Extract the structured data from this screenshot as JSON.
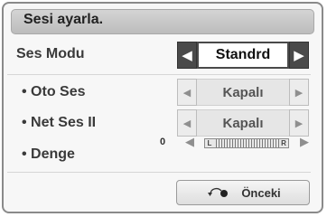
{
  "title": "Sesi ayarla.",
  "rows": {
    "ses_modu": {
      "label": "Ses Modu",
      "value": "Standrd",
      "left_icon": "left-arrow-icon",
      "right_icon": "right-arrow-icon"
    },
    "oto_ses": {
      "label": "• Oto Ses",
      "value": "Kapalı"
    },
    "net_ses": {
      "label": "• Net Ses II",
      "value": "Kapalı"
    },
    "denge": {
      "label": "• Denge",
      "value": "0",
      "left_mark": "L",
      "right_mark": "R",
      "level": 0.5
    }
  },
  "back_button": {
    "label": "Önceki",
    "icon": "return-icon"
  },
  "glyphs": {
    "left": "◀",
    "right": "▶"
  }
}
